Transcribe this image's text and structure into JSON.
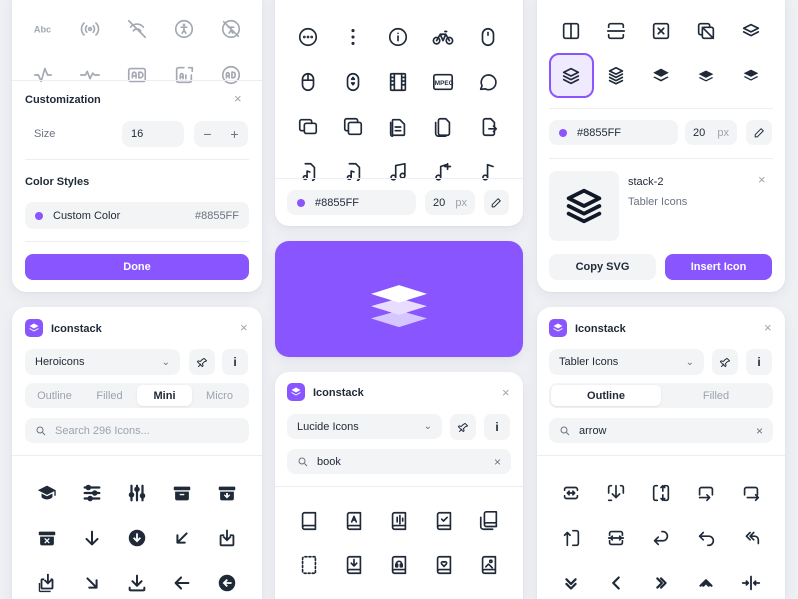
{
  "colors": {
    "accent": "#8855ff",
    "accent_light": "#efeafd",
    "card": "#ffffff",
    "bg": "#eef0f4"
  },
  "customization_card": {
    "top_icons_row1": [
      "text-abc-icon",
      "broadcast-icon",
      "wifi-off-icon",
      "accessible-icon",
      "accessible-off-icon"
    ],
    "top_icons_row2": [
      "activity-icon",
      "heartbeat-icon",
      "ad-icon",
      "ad-2-icon",
      "badge-ad-icon"
    ],
    "title": "Customization",
    "size_label": "Size",
    "size_value": "16",
    "minus": "−",
    "plus": "+",
    "color_styles_title": "Color Styles",
    "custom_color_label": "Custom Color",
    "custom_color_value": "#8855FF",
    "done_label": "Done",
    "close": "×"
  },
  "middle_top_card": {
    "icon_names": [
      "dots-circle-icon",
      "dots-vertical-icon",
      "info-circle-icon",
      "bike-icon",
      "mouse-icon",
      "mouse-2-icon",
      "mouse-scroll-icon",
      "film-icon",
      "mpeg-icon",
      "message-circle-icon",
      "copy-icon",
      "box-multiple-icon",
      "files-icon",
      "file-copy-icon",
      "file-export-icon",
      "file-music-icon",
      "file-music-2-icon",
      "music-icon",
      "music-plus-icon",
      "music-note-icon"
    ],
    "mpeg_text": "MPEG",
    "color_value": "#8855FF",
    "size_value": "20",
    "size_unit": "px"
  },
  "hero_card": {
    "icon": "stack-icon"
  },
  "right_top_card": {
    "row1": [
      "layout-columns-icon",
      "layout-rows-icon",
      "square-x-icon",
      "box-multiple-icon",
      "stack-outline-icon"
    ],
    "row2": [
      "stack-2-icon",
      "stack-3-icon",
      "stack-filled-icon",
      "stack-push-icon",
      "stack-pop-icon"
    ],
    "color_value": "#8855FF",
    "size_value": "20",
    "size_unit": "px",
    "icon_name": "stack-2",
    "icon_library": "Tabler Icons",
    "copy_label": "Copy SVG",
    "insert_label": "Insert Icon",
    "close": "×"
  },
  "iconstack_left": {
    "title": "Iconstack",
    "library": "Heroicons",
    "tabs": [
      "Outline",
      "Filled",
      "Mini",
      "Micro"
    ],
    "active_tab": "Mini",
    "search_placeholder": "Search 296 Icons...",
    "info": "i",
    "close": "×",
    "icons": [
      "academic-cap-icon",
      "adjustments-horizontal-icon",
      "adjustments-vertical-icon",
      "archive-box-icon",
      "archive-box-arrow-down-icon",
      "archive-box-x-mark-icon",
      "arrow-down-icon",
      "arrow-down-circle-icon",
      "arrow-down-left-icon",
      "arrow-down-on-square-icon",
      "arrow-down-on-square-stack-icon",
      "arrow-down-right-icon",
      "arrow-down-tray-icon",
      "arrow-left-icon",
      "arrow-left-circle-icon"
    ]
  },
  "iconstack_middle": {
    "title": "Iconstack",
    "library": "Lucide Icons",
    "search_value": "book",
    "info": "i",
    "close": "×",
    "icons": [
      "book-icon",
      "book-a-icon",
      "book-audio-icon",
      "book-check-icon",
      "book-copy-icon",
      "book-dashed-icon",
      "book-down-icon",
      "book-headphones-icon",
      "book-heart-icon",
      "book-image-icon"
    ]
  },
  "iconstack_right": {
    "title": "Iconstack",
    "library": "Tabler Icons",
    "tabs": [
      "Outline",
      "Filled"
    ],
    "active_tab": "Outline",
    "search_value": "arrow",
    "info": "i",
    "close": "×",
    "icons": [
      "arrow-autofit-height-icon",
      "arrow-bar-to-down-icon",
      "arrow-autofit-content-icon",
      "arrow-back-up-icon",
      "arrow-bar-right-icon",
      "arrow-bar-up-icon",
      "arrow-autofit-width-icon",
      "arrow-back-icon",
      "arrow-back-up-2-icon",
      "arrows-left-double-icon",
      "chevrons-down-icon",
      "chevron-left-pipe-icon",
      "chevrons-right-icon",
      "chevron-up-icon",
      "arrows-horizontal-icon"
    ]
  }
}
